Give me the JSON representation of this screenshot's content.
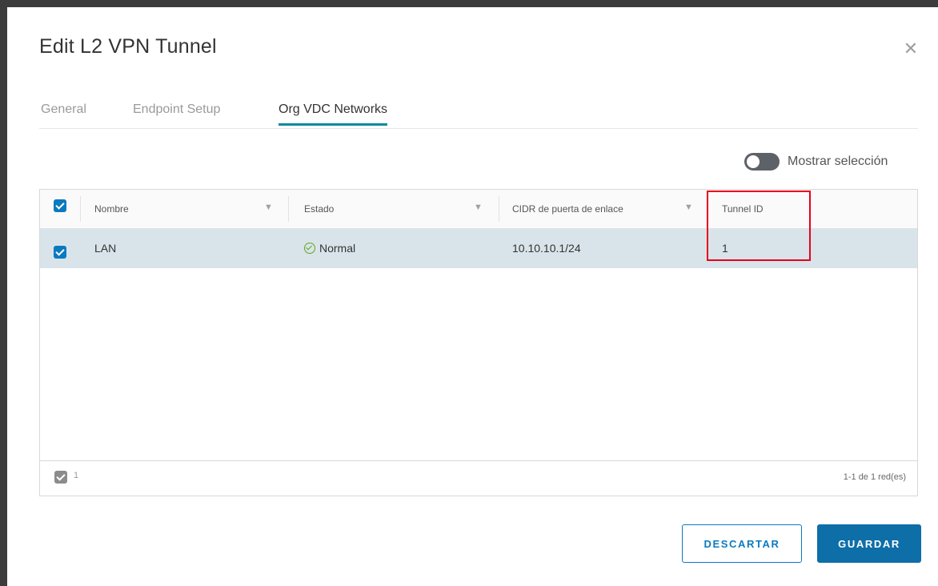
{
  "dialog": {
    "title": "Edit L2 VPN Tunnel",
    "close_icon": "close-icon"
  },
  "tabs": [
    {
      "label": "General",
      "active": false
    },
    {
      "label": "Endpoint Setup",
      "active": false
    },
    {
      "label": "Org VDC Networks",
      "active": true
    }
  ],
  "toggle": {
    "label": "Mostrar selección",
    "on": false
  },
  "table": {
    "select_all_checked": true,
    "columns": [
      {
        "label": "Nombre",
        "filter_icon": "filter-icon"
      },
      {
        "label": "Estado",
        "filter_icon": "filter-icon"
      },
      {
        "label": "CIDR de puerta de enlace",
        "filter_icon": "filter-icon"
      },
      {
        "label": "Tunnel ID"
      }
    ],
    "rows": [
      {
        "checked": true,
        "name": "LAN",
        "status": "Normal",
        "status_icon": "check-circle-icon",
        "cidr": "10.10.10.1/24",
        "tunnel_id": "1"
      }
    ],
    "footer": {
      "selected_count": "1",
      "pagination": "1-1 de 1 red(es)"
    }
  },
  "buttons": {
    "discard": "DESCARTAR",
    "save": "GUARDAR"
  },
  "colors": {
    "primary": "#0b7ac0",
    "tab_underline": "#0d8a9a",
    "selected_row": "#d9e4ea",
    "highlight": "#e8001c",
    "status_ok": "#62a420"
  }
}
